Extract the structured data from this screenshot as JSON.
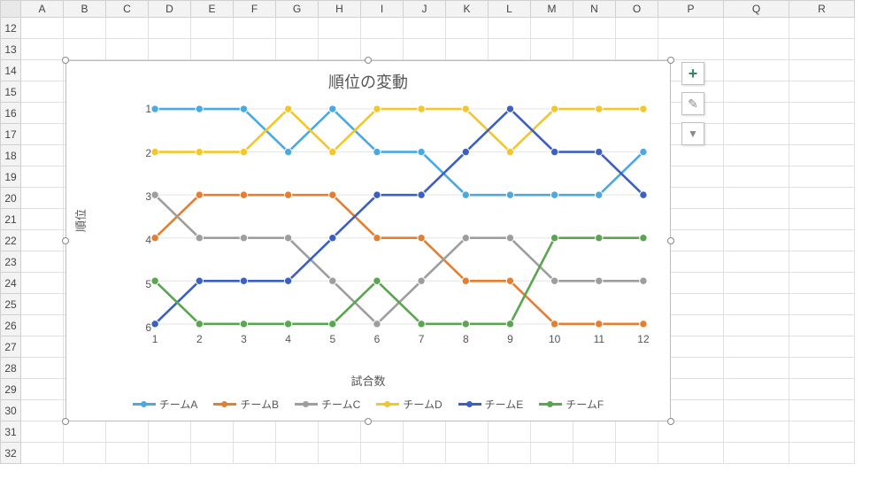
{
  "columns": [
    "A",
    "B",
    "C",
    "D",
    "E",
    "F",
    "G",
    "H",
    "I",
    "J",
    "K",
    "L",
    "M",
    "N",
    "O",
    "P",
    "Q",
    "R"
  ],
  "rows": [
    "12",
    "13",
    "14",
    "15",
    "16",
    "17",
    "18",
    "19",
    "20",
    "21",
    "22",
    "23",
    "24",
    "25",
    "26",
    "27",
    "28",
    "29",
    "30",
    "31",
    "32"
  ],
  "side_buttons": {
    "add": "+",
    "brush": "✎",
    "filter": "▼"
  },
  "chart_data": {
    "type": "line",
    "title": "順位の変動",
    "xlabel": "試合数",
    "ylabel": "順位",
    "x": [
      1,
      2,
      3,
      4,
      5,
      6,
      7,
      8,
      9,
      10,
      11,
      12
    ],
    "ylim": [
      1,
      6
    ],
    "y_reversed": true,
    "series": [
      {
        "name": "チームA",
        "color": "#4aa9e0",
        "values": [
          1,
          1,
          1,
          2,
          1,
          2,
          2,
          3,
          3,
          3,
          3,
          2
        ]
      },
      {
        "name": "チームB",
        "color": "#e57f2f",
        "values": [
          4,
          3,
          3,
          3,
          3,
          4,
          4,
          5,
          5,
          6,
          6,
          6
        ]
      },
      {
        "name": "チームC",
        "color": "#9e9e9e",
        "values": [
          3,
          4,
          4,
          4,
          5,
          6,
          5,
          4,
          4,
          5,
          5,
          5
        ]
      },
      {
        "name": "チームD",
        "color": "#f3c62c",
        "values": [
          2,
          2,
          2,
          1,
          2,
          1,
          1,
          1,
          2,
          1,
          1,
          1
        ]
      },
      {
        "name": "チームE",
        "color": "#3c5fc2",
        "values": [
          6,
          5,
          5,
          5,
          4,
          3,
          3,
          2,
          1,
          2,
          2,
          3
        ]
      },
      {
        "name": "チームF",
        "color": "#5aa54f",
        "values": [
          5,
          6,
          6,
          6,
          6,
          5,
          6,
          6,
          6,
          4,
          4,
          4
        ]
      }
    ]
  }
}
